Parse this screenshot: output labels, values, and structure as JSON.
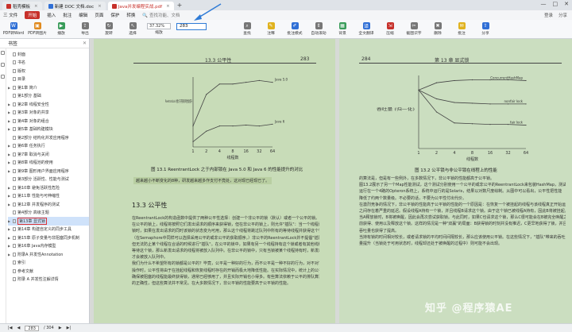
{
  "tabs": [
    {
      "label": "稻壳模板",
      "color": "#c7302a"
    },
    {
      "label": "新建 DOC 文档.doc",
      "color": "#2f6fd6"
    },
    {
      "label": "Java并发编程实战.pdf",
      "color": "#c7302a"
    }
  ],
  "menu": {
    "file": "三 文件",
    "start": "开始",
    "items": [
      "插入",
      "批注",
      "编辑",
      "页面",
      "保护",
      "转换"
    ],
    "search": "查找功能、文档",
    "right": [
      "登录",
      "分享"
    ]
  },
  "toolbar": {
    "items": [
      "PDF转Word",
      "PDF转图片",
      "播放",
      "导出",
      "旋转",
      "选择",
      "缩放"
    ],
    "zoom": "37.32%",
    "page": "283",
    "items2": [
      "查找",
      "注释",
      "批注模式",
      "自动滚动",
      "背景",
      "全文翻译",
      "压缩",
      "截图识字",
      "删除",
      "批注",
      "分享"
    ]
  },
  "sidebar": {
    "title": "书签",
    "toc": [
      {
        "label": "封面",
        "arrow": false
      },
      {
        "label": "书名",
        "arrow": false
      },
      {
        "label": "版权",
        "arrow": false
      },
      {
        "label": "目录",
        "arrow": false
      },
      {
        "label": "第1章 简介",
        "arrow": true
      },
      {
        "label": "第1部分 基础",
        "arrow": false
      },
      {
        "label": "第2章 线程安全性",
        "arrow": true
      },
      {
        "label": "第3章 对象的共享",
        "arrow": true
      },
      {
        "label": "第4章 对象的组合",
        "arrow": true
      },
      {
        "label": "第5章 基础构建模块",
        "arrow": true
      },
      {
        "label": "第2部分 结构化并发应用程序",
        "arrow": false
      },
      {
        "label": "第6章 任务执行",
        "arrow": true
      },
      {
        "label": "第7章 取消与关闭",
        "arrow": true
      },
      {
        "label": "第8章 线程池的使用",
        "arrow": true
      },
      {
        "label": "第9章 图形用户界面应用程序",
        "arrow": true
      },
      {
        "label": "第3部分 活跃性、性能与测试",
        "arrow": false
      },
      {
        "label": "第10章 避免活跃性危险",
        "arrow": true
      },
      {
        "label": "第11章 性能与可伸缩性",
        "arrow": true
      },
      {
        "label": "第12章 并发程序的测试",
        "arrow": true
      },
      {
        "label": "第4部分 高级主题",
        "arrow": false
      },
      {
        "label": "第13章 显式锁",
        "arrow": true,
        "selected": true
      },
      {
        "label": "第14章 构建自定义的同步工具",
        "arrow": true
      },
      {
        "label": "第15章 原子变量与非阻塞同步机制",
        "arrow": true
      },
      {
        "label": "第16章 Java内存模型",
        "arrow": true
      },
      {
        "label": "附录A 并发性Annotation",
        "arrow": true
      },
      {
        "label": "索引",
        "arrow": false
      },
      {
        "label": "参考文献",
        "arrow": false
      },
      {
        "label": "附录 A 并发性注解详情",
        "arrow": false
      }
    ]
  },
  "left_page": {
    "header": "13.3 公平性",
    "number": "283",
    "figure_caption": "图 13.1 ReentrantLock 之于内部锁在 Java 5.0 和 Java 6 的性能提升的对比",
    "highlight": "越来越小不断变化的8种，研发越来越多作支付不竟处，这对现已经现已了。",
    "section": "13.3 公平性",
    "lines": [
      "在ReentrantLock的构造函数中提供了两种公平性选择：创建一个非公平的锁（默认）或者一个公平的锁。",
      "在公平的锁上，线程将按照它们发出请求的顺序来获得锁，但在非公平的锁上，则允许\"插队\"：当一个线程请求非公平的",
      "锁时，如果在发出请求的同时该锁的状态变为可用，那么这个线程将跳过队列中所有的等待线程并获得这个锁。",
      "（在Semaphore中同样可以选择采用公平的或非公平的获取顺序。）非公平的ReentrantLock并不提倡\"插队\"行为，",
      "但无法防止某个线程在合适的时候进行\"插队\"。在公平的锁中，如果有另一个线程持有这个锁或者有其他线程在队列中",
      "等待这个锁，那么新发出请求的线程将被放入队列中。在非公平的锁中，只有当锁被某个线程持有时，新发出请求的线程",
      "才会被放入队列中。",
      "我们为什么不希望所有的锁都是公平的？毕竟，公平是一种好的行为，而不公平是一种不好的行为，对不对？当执行加锁",
      "操作时，公平性将由于在挂起线程和恢复线程时存在的开销而极大地降低性能。在实际情况中，统计上的公平性保证——",
      "确保被阻塞的线程能最终获得锁，通常已经够用了，并且实际开销也小得多。有些算法依赖于公平的排队算法以确保它们",
      "的正确性，但这些算法并不常见。在大多数情况下，非公平锁的性能要高于公平锁的性能。"
    ]
  },
  "right_page": {
    "number": "284",
    "header": "第 13 章 显式锁",
    "figure_caption": "图 13.2 公平锁与非公平锁在线程上的性能",
    "lines": [
      "的算法是，但是有一些例外，在多数情况下，非公平锁的性能都高于公平锁。",
      "图13.2展示了另一个Map性能测试，这个测试分别使用一个公平的或非公平的ReentrantLock来包装HashMap，测试",
      "运行在一个4路的Opteron系统上，系统中运行的是Solaris，结果以对数尺度绘制。从图中可以看出，公平性把性能",
      "降低了约两个数量级。不必要的话，不要为公平性付出代价。",
      "在激烈竞争的情况下，非公平锁的性能高于公平锁的性能的一个原因是：在恢复一个被挂起的线程与该线程真正开始运行",
      "之间存在着严重的延迟。假设线程A持有一个锁，并且线程B请求这个锁。由于这个锁已被线程A持有，因此B将被挂起。",
      "当A释放锁时，B将被唤醒，因此会再次尝试获取锁。与此同时，如果C也请求这个锁，那么C很可能会在B被完全唤醒之",
      "前获得、使用以及释放这个锁。这样的情况是一种\"双赢\"的局面：B获得锁的时刻并没有推迟，C更早地获得了锁，并且",
      "吞吐量也获得了提高。",
      "当持有锁的时间相对较长，或者请求锁的平均时间间隔较长，那么应该使用公平锁。在这些情况下，\"插队\"带来的吞吐",
      "量提升（当锁处于可用状态时，线程却还处于被唤醒的过程中）则可能不会出现。"
    ]
  },
  "status": {
    "page": "283",
    "total": "/ 304"
  },
  "watermark": "知乎 @程序猿AE",
  "chart_data": [
    {
      "type": "line",
      "title": "",
      "ylabel": "ReentrantLock 相比于内部锁的性能提升",
      "xlabel": "线程数",
      "x": [
        1,
        2,
        4,
        8,
        16,
        32,
        64
      ],
      "series": [
        {
          "name": "Java 5.0",
          "values": [
            1.2,
            3.0,
            3.6,
            3.6,
            3.7,
            3.8,
            3.7
          ]
        },
        {
          "name": "Java 6",
          "values": [
            0.3,
            0.9,
            1.2,
            1.2,
            1.25,
            1.2,
            1.3
          ]
        }
      ],
      "ylim": [
        0,
        4
      ]
    },
    {
      "type": "line",
      "title": "",
      "ylabel": "吞吐量 (归一化)",
      "xlabel": "线程数",
      "x": [
        1,
        2,
        4,
        8,
        16,
        32,
        64
      ],
      "series": [
        {
          "name": "ConcurrentHashMap",
          "values": [
            8,
            9,
            9.3,
            9.4,
            9.4,
            9.4,
            9.3
          ]
        },
        {
          "name": "nonfair lock",
          "values": [
            8,
            6.8,
            6.3,
            6.2,
            6.1,
            6.1,
            6.1
          ]
        },
        {
          "name": "fair lock",
          "values": [
            8,
            5,
            3.5,
            3.4,
            3.3,
            3.3,
            3.2
          ]
        }
      ],
      "ylim": [
        0,
        10
      ]
    }
  ]
}
